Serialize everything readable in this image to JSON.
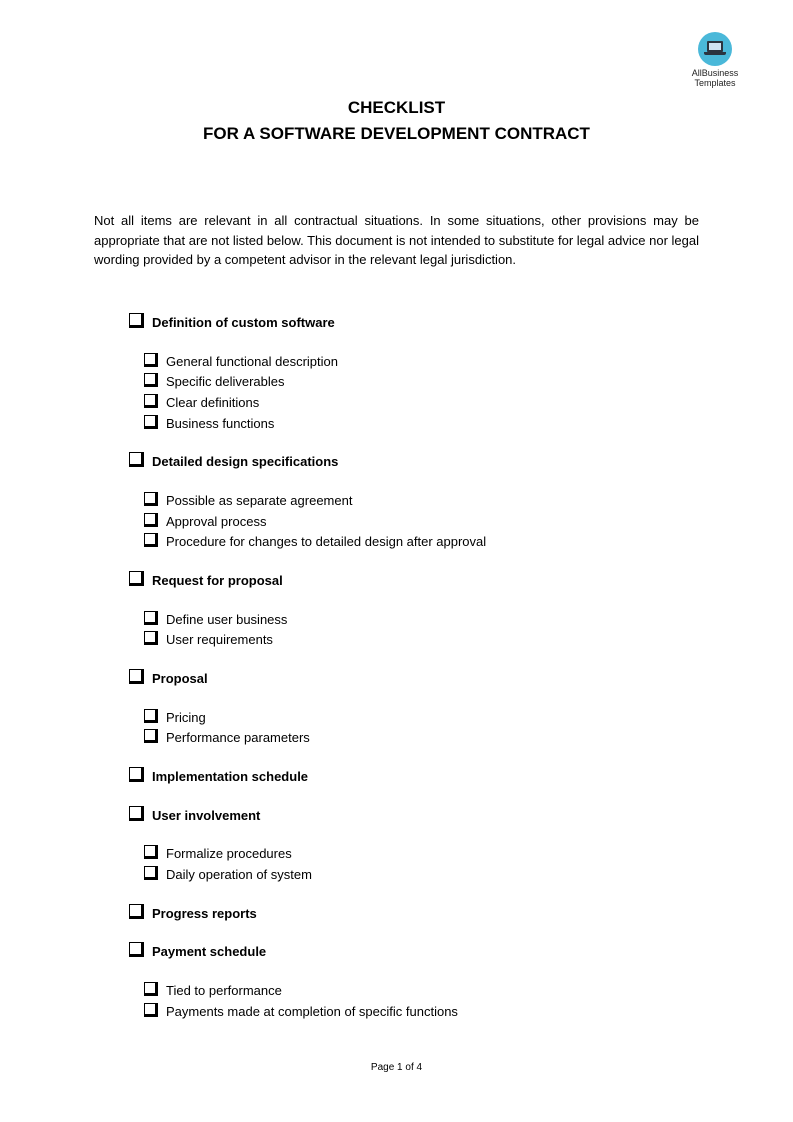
{
  "logo": {
    "icon": "laptop-icon",
    "line1": "AllBusiness",
    "line2": "Templates",
    "color": "#4ab8d9"
  },
  "title": "CHECKLIST",
  "subtitle": "FOR A SOFTWARE DEVELOPMENT CONTRACT",
  "intro": "Not all items are relevant in all contractual situations. In some situations, other provisions may be appropriate that are not listed below. This document is not intended to substitute for legal advice nor legal wording provided by a competent advisor in the relevant legal jurisdiction.",
  "checklist": [
    {
      "label": "Definition of custom software",
      "checked": false,
      "items": [
        {
          "label": "General functional description",
          "checked": false
        },
        {
          "label": "Specific deliverables",
          "checked": false
        },
        {
          "label": "Clear definitions",
          "checked": false
        },
        {
          "label": "Business functions",
          "checked": false
        }
      ]
    },
    {
      "label": "Detailed design specifications",
      "checked": false,
      "items": [
        {
          "label": "Possible as separate agreement",
          "checked": false
        },
        {
          "label": "Approval process",
          "checked": false
        },
        {
          "label": "Procedure for changes to detailed design after approval",
          "checked": false
        }
      ]
    },
    {
      "label": "Request for proposal",
      "checked": false,
      "items": [
        {
          "label": "Define user business",
          "checked": false
        },
        {
          "label": "User requirements",
          "checked": false
        }
      ]
    },
    {
      "label": "Proposal",
      "checked": false,
      "items": [
        {
          "label": "Pricing",
          "checked": false
        },
        {
          "label": "Performance parameters",
          "checked": false
        }
      ]
    },
    {
      "label": "Implementation schedule",
      "checked": false,
      "items": []
    },
    {
      "label": "User involvement",
      "checked": false,
      "items": [
        {
          "label": "Formalize procedures",
          "checked": false
        },
        {
          "label": "Daily operation of system",
          "checked": false
        }
      ]
    },
    {
      "label": "Progress reports",
      "checked": false,
      "items": []
    },
    {
      "label": "Payment schedule",
      "checked": false,
      "items": [
        {
          "label": "Tied to performance",
          "checked": false
        },
        {
          "label": "Payments made at completion of specific functions",
          "checked": false
        }
      ]
    }
  ],
  "footer": "Page 1 of 4"
}
